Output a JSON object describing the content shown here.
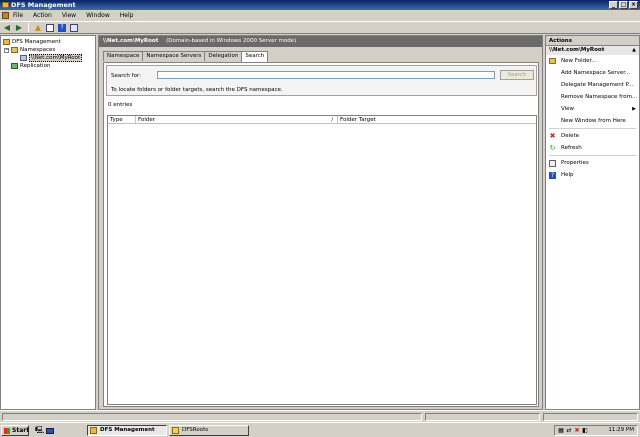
{
  "window": {
    "title": "DFS Management"
  },
  "menu": [
    "File",
    "Action",
    "View",
    "Window",
    "Help"
  ],
  "tree": {
    "root": "DFS Management",
    "namespaces": "Namespaces",
    "namespace_item": "\\\\Net.com\\MyRoot",
    "replication": "Replication"
  },
  "center": {
    "header_title": "\\\\Net.com\\MyRoot",
    "header_subtitle": "(Domain-based in Windows 2000 Server mode)",
    "tabs": [
      "Namespace",
      "Namespace Servers",
      "Delegation",
      "Search"
    ],
    "search": {
      "label": "Search for:",
      "value": "",
      "button": "Search",
      "hint": "To locate folders or folder targets, search the DFS namespace."
    },
    "entries": "0 entries",
    "columns": {
      "type": "Type",
      "folder": "Folder",
      "target": "Folder Target"
    }
  },
  "actions": {
    "title": "Actions",
    "subhead": "\\\\Net.com\\MyRoot",
    "items": [
      "New Folder...",
      "Add Namespace Server...",
      "Delegate Management P...",
      "Remove Namespace from...",
      "View",
      "New Window from Here",
      "Delete",
      "Refresh",
      "Properties",
      "Help"
    ]
  },
  "taskbar": {
    "start": "Start",
    "tasks": [
      "DFS Management",
      "DFSRoots"
    ],
    "clock": "11:29 PM"
  }
}
